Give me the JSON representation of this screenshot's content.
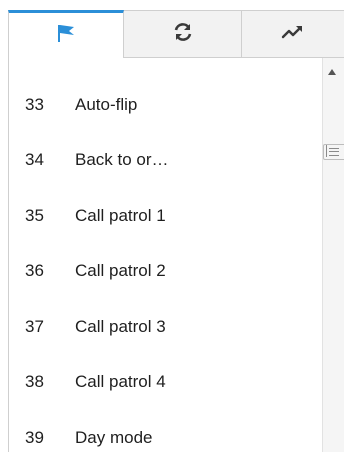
{
  "tabs": [
    {
      "icon": "flag-icon",
      "active": true
    },
    {
      "icon": "refresh-icon",
      "active": false
    },
    {
      "icon": "trend-icon",
      "active": false
    }
  ],
  "colors": {
    "accent": "#2b8fd8",
    "tab_inactive_bg": "#f2f2f2",
    "border": "#cfcfcf",
    "text": "#1f1f1f"
  },
  "presets": {
    "items": [
      {
        "num": "33",
        "name": "Auto-flip"
      },
      {
        "num": "34",
        "name": "Back to or…"
      },
      {
        "num": "35",
        "name": "Call patrol 1"
      },
      {
        "num": "36",
        "name": "Call patrol 2"
      },
      {
        "num": "37",
        "name": "Call patrol 3"
      },
      {
        "num": "38",
        "name": "Call patrol 4"
      },
      {
        "num": "39",
        "name": "Day mode"
      }
    ]
  }
}
